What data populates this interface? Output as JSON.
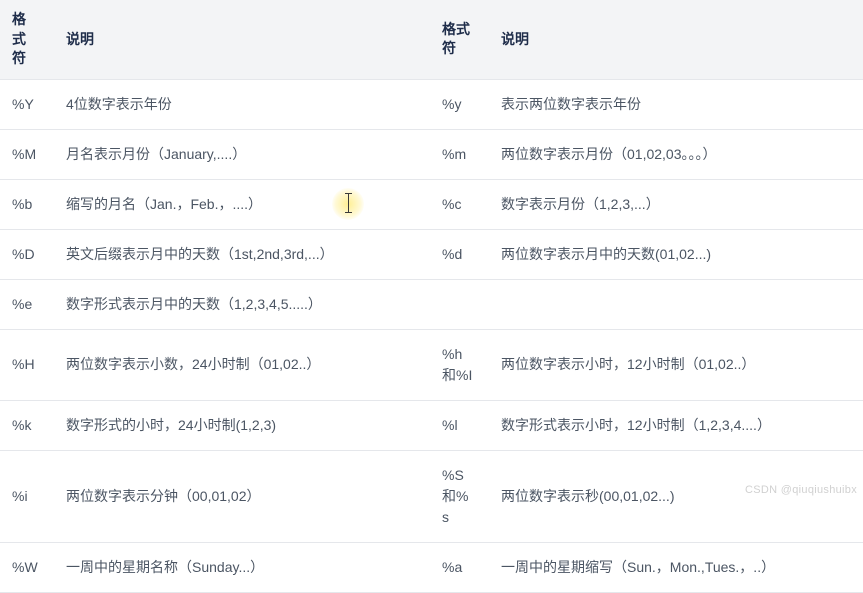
{
  "headers": {
    "fmt1": "格式符",
    "desc1": "说明",
    "fmt2": "格式符",
    "desc2": "说明"
  },
  "rows": [
    {
      "f1": "%Y",
      "d1": "4位数字表示年份",
      "f2": "%y",
      "d2": "表示两位数字表示年份"
    },
    {
      "f1": "%M",
      "d1": "月名表示月份（January,....）",
      "f2": "%m",
      "d2": "两位数字表示月份（01,02,03。。。）"
    },
    {
      "f1": "%b",
      "d1": "缩写的月名（Jan.，Feb.，....）",
      "f2": "%c",
      "d2": "数字表示月份（1,2,3,...）"
    },
    {
      "f1": "%D",
      "d1": "英文后缀表示月中的天数（1st,2nd,3rd,...）",
      "f2": "%d",
      "d2": "两位数字表示月中的天数(01,02...)"
    },
    {
      "f1": "%e",
      "d1": "数字形式表示月中的天数（1,2,3,4,5.....）",
      "f2": "",
      "d2": ""
    },
    {
      "f1": "%H",
      "d1": "两位数字表示小数，24小时制（01,02..）",
      "f2": "%h和%I",
      "d2": "两位数字表示小时，12小时制（01,02..）"
    },
    {
      "f1": "%k",
      "d1": "数字形式的小时，24小时制(1,2,3)",
      "f2": "%l",
      "d2": "数字形式表示小时，12小时制（1,2,3,4....）"
    },
    {
      "f1": "%i",
      "d1": "两位数字表示分钟（00,01,02）",
      "f2": "%S和%s",
      "d2": "两位数字表示秒(00,01,02...)"
    },
    {
      "f1": "%W",
      "d1": "一周中的星期名称（Sunday...）",
      "f2": "%a",
      "d2": "一周中的星期缩写（Sun.，Mon.,Tues.，..）"
    }
  ],
  "watermark": "CSDN @qiuqiushuibx"
}
